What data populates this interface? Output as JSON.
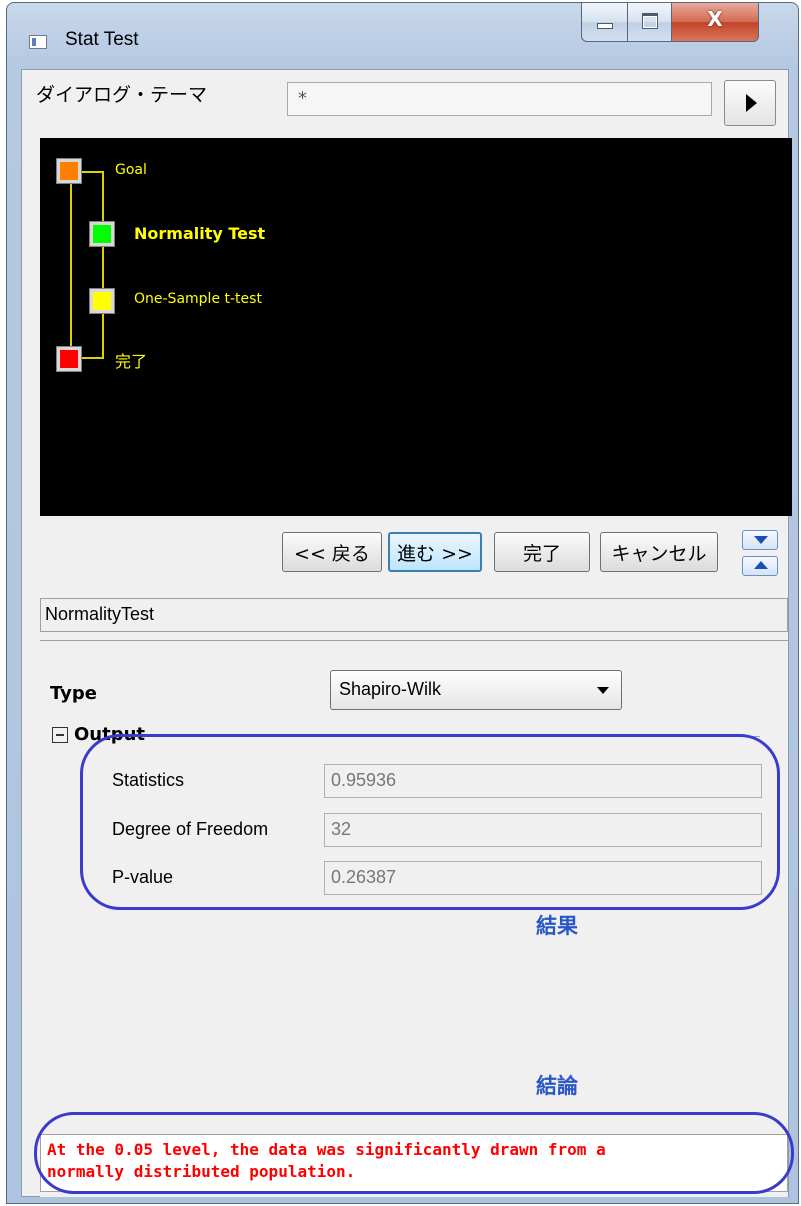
{
  "window": {
    "title": "Stat Test",
    "close_glyph": "X"
  },
  "theme": {
    "label": "ダイアログ・テーマ",
    "value": "*"
  },
  "tree": {
    "nodes": [
      {
        "label": "Goal",
        "color": "#ff8000"
      },
      {
        "label": "Normality Test",
        "color": "#00ff00"
      },
      {
        "label": "One-Sample t-test",
        "color": "#ffff00"
      },
      {
        "label": "完了",
        "color": "#ff0000"
      }
    ]
  },
  "nav": {
    "back": "<< 戻る",
    "next": "進む >>",
    "finish": "完了",
    "cancel": "キャンセル"
  },
  "page_name": "NormalityTest",
  "type": {
    "label": "Type",
    "value": "Shapiro-Wilk"
  },
  "output": {
    "label": "Output",
    "rows": [
      {
        "label": "Statistics",
        "value": "0.95936"
      },
      {
        "label": "Degree of Freedom",
        "value": "32"
      },
      {
        "label": "P-value",
        "value": "0.26387"
      }
    ]
  },
  "annotations": {
    "result": "結果",
    "conclusion": "結論"
  },
  "conclusion": {
    "line1": "At the 0.05 level, the data was significantly drawn from a",
    "line2": "normally distributed population."
  }
}
